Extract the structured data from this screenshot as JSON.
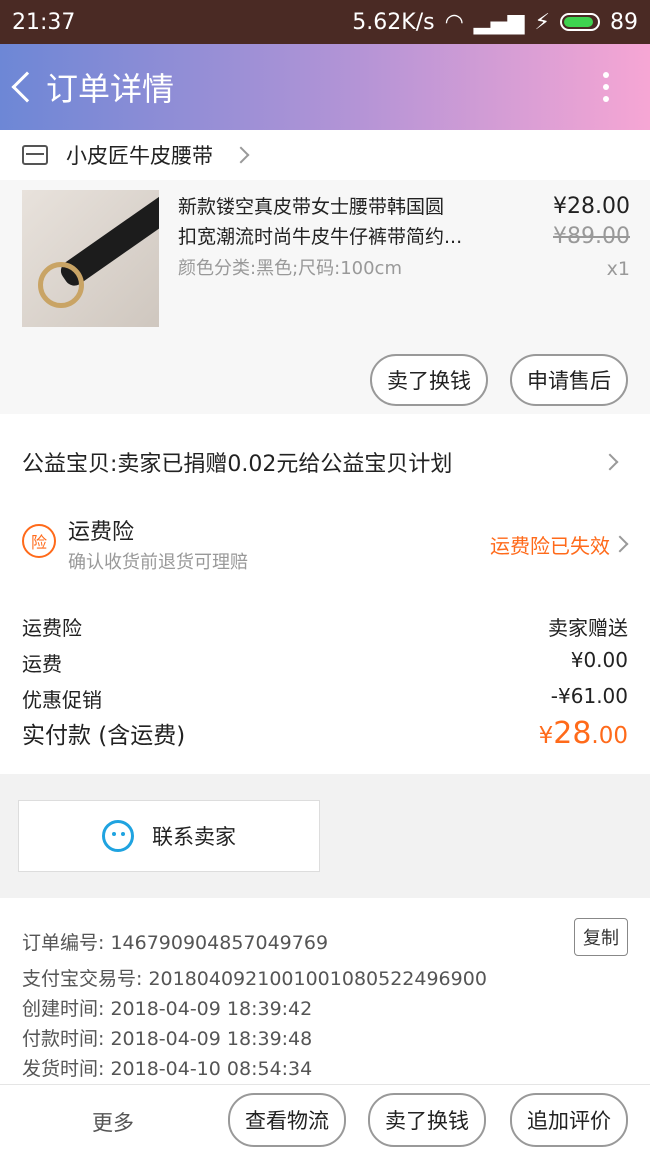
{
  "statusbar": {
    "time": "21:37",
    "speed": "5.62K/s",
    "battery": "89"
  },
  "appbar": {
    "title": "订单详情"
  },
  "store": {
    "name": "小皮匠牛皮腰带"
  },
  "item": {
    "name_line1": "新款镂空真皮带女士腰带韩国圆",
    "name_line2": "扣宽潮流时尚牛皮牛仔裤带简约...",
    "sku": "颜色分类:黑色;尺码:100cm",
    "price": "¥28.00",
    "original_price": "¥89.00",
    "quantity": "x1",
    "btn_resell": "卖了换钱",
    "btn_after_sale": "申请售后"
  },
  "charity": {
    "text": "公益宝贝:卖家已捐赠0.02元给公益宝贝计划"
  },
  "insurance": {
    "icon_char": "险",
    "title": "运费险",
    "subtitle": "确认收货前退货可理赔",
    "status": "运费险已失效"
  },
  "fees": {
    "rows": [
      {
        "label": "运费险",
        "value": "卖家赠送"
      },
      {
        "label": "运费",
        "value": "¥0.00"
      },
      {
        "label": "优惠促销",
        "value": "-¥61.00"
      }
    ],
    "total_label": "实付款 (含运费)",
    "total_currency": "¥",
    "total_int": "28",
    "total_dec": ".00"
  },
  "contact": {
    "label": "联系卖家"
  },
  "order_info": {
    "order_no": "订单编号: 146790904857049769",
    "alipay_no": "支付宝交易号: 2018040921001001080522496900",
    "created": "创建时间: 2018-04-09 18:39:42",
    "paid": "付款时间: 2018-04-09 18:39:48",
    "shipped": "发货时间: 2018-04-10 08:54:34",
    "copy_label": "复制"
  },
  "bottombar": {
    "more": "更多",
    "logistics": "查看物流",
    "resell": "卖了换钱",
    "review": "追加评价"
  },
  "colors": {
    "accent": "#ff6a1a",
    "wangwang": "#1fa3e0"
  }
}
